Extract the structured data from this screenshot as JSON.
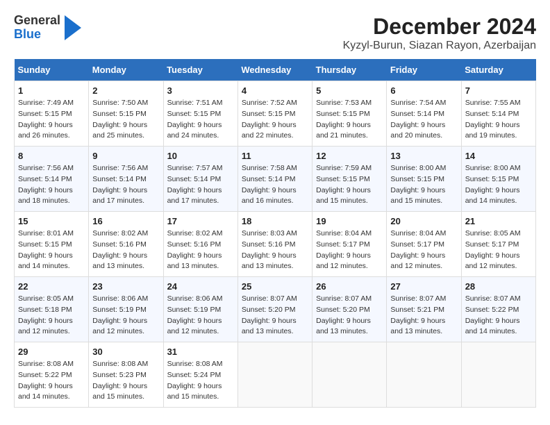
{
  "logo": {
    "general": "General",
    "blue": "Blue"
  },
  "title": "December 2024",
  "subtitle": "Kyzyl-Burun, Siazan Rayon, Azerbaijan",
  "headers": [
    "Sunday",
    "Monday",
    "Tuesday",
    "Wednesday",
    "Thursday",
    "Friday",
    "Saturday"
  ],
  "weeks": [
    [
      {
        "day": "1",
        "sunrise": "Sunrise: 7:49 AM",
        "sunset": "Sunset: 5:15 PM",
        "daylight": "Daylight: 9 hours and 26 minutes."
      },
      {
        "day": "2",
        "sunrise": "Sunrise: 7:50 AM",
        "sunset": "Sunset: 5:15 PM",
        "daylight": "Daylight: 9 hours and 25 minutes."
      },
      {
        "day": "3",
        "sunrise": "Sunrise: 7:51 AM",
        "sunset": "Sunset: 5:15 PM",
        "daylight": "Daylight: 9 hours and 24 minutes."
      },
      {
        "day": "4",
        "sunrise": "Sunrise: 7:52 AM",
        "sunset": "Sunset: 5:15 PM",
        "daylight": "Daylight: 9 hours and 22 minutes."
      },
      {
        "day": "5",
        "sunrise": "Sunrise: 7:53 AM",
        "sunset": "Sunset: 5:15 PM",
        "daylight": "Daylight: 9 hours and 21 minutes."
      },
      {
        "day": "6",
        "sunrise": "Sunrise: 7:54 AM",
        "sunset": "Sunset: 5:14 PM",
        "daylight": "Daylight: 9 hours and 20 minutes."
      },
      {
        "day": "7",
        "sunrise": "Sunrise: 7:55 AM",
        "sunset": "Sunset: 5:14 PM",
        "daylight": "Daylight: 9 hours and 19 minutes."
      }
    ],
    [
      {
        "day": "8",
        "sunrise": "Sunrise: 7:56 AM",
        "sunset": "Sunset: 5:14 PM",
        "daylight": "Daylight: 9 hours and 18 minutes."
      },
      {
        "day": "9",
        "sunrise": "Sunrise: 7:56 AM",
        "sunset": "Sunset: 5:14 PM",
        "daylight": "Daylight: 9 hours and 17 minutes."
      },
      {
        "day": "10",
        "sunrise": "Sunrise: 7:57 AM",
        "sunset": "Sunset: 5:14 PM",
        "daylight": "Daylight: 9 hours and 17 minutes."
      },
      {
        "day": "11",
        "sunrise": "Sunrise: 7:58 AM",
        "sunset": "Sunset: 5:14 PM",
        "daylight": "Daylight: 9 hours and 16 minutes."
      },
      {
        "day": "12",
        "sunrise": "Sunrise: 7:59 AM",
        "sunset": "Sunset: 5:15 PM",
        "daylight": "Daylight: 9 hours and 15 minutes."
      },
      {
        "day": "13",
        "sunrise": "Sunrise: 8:00 AM",
        "sunset": "Sunset: 5:15 PM",
        "daylight": "Daylight: 9 hours and 15 minutes."
      },
      {
        "day": "14",
        "sunrise": "Sunrise: 8:00 AM",
        "sunset": "Sunset: 5:15 PM",
        "daylight": "Daylight: 9 hours and 14 minutes."
      }
    ],
    [
      {
        "day": "15",
        "sunrise": "Sunrise: 8:01 AM",
        "sunset": "Sunset: 5:15 PM",
        "daylight": "Daylight: 9 hours and 14 minutes."
      },
      {
        "day": "16",
        "sunrise": "Sunrise: 8:02 AM",
        "sunset": "Sunset: 5:16 PM",
        "daylight": "Daylight: 9 hours and 13 minutes."
      },
      {
        "day": "17",
        "sunrise": "Sunrise: 8:02 AM",
        "sunset": "Sunset: 5:16 PM",
        "daylight": "Daylight: 9 hours and 13 minutes."
      },
      {
        "day": "18",
        "sunrise": "Sunrise: 8:03 AM",
        "sunset": "Sunset: 5:16 PM",
        "daylight": "Daylight: 9 hours and 13 minutes."
      },
      {
        "day": "19",
        "sunrise": "Sunrise: 8:04 AM",
        "sunset": "Sunset: 5:17 PM",
        "daylight": "Daylight: 9 hours and 12 minutes."
      },
      {
        "day": "20",
        "sunrise": "Sunrise: 8:04 AM",
        "sunset": "Sunset: 5:17 PM",
        "daylight": "Daylight: 9 hours and 12 minutes."
      },
      {
        "day": "21",
        "sunrise": "Sunrise: 8:05 AM",
        "sunset": "Sunset: 5:17 PM",
        "daylight": "Daylight: 9 hours and 12 minutes."
      }
    ],
    [
      {
        "day": "22",
        "sunrise": "Sunrise: 8:05 AM",
        "sunset": "Sunset: 5:18 PM",
        "daylight": "Daylight: 9 hours and 12 minutes."
      },
      {
        "day": "23",
        "sunrise": "Sunrise: 8:06 AM",
        "sunset": "Sunset: 5:19 PM",
        "daylight": "Daylight: 9 hours and 12 minutes."
      },
      {
        "day": "24",
        "sunrise": "Sunrise: 8:06 AM",
        "sunset": "Sunset: 5:19 PM",
        "daylight": "Daylight: 9 hours and 12 minutes."
      },
      {
        "day": "25",
        "sunrise": "Sunrise: 8:07 AM",
        "sunset": "Sunset: 5:20 PM",
        "daylight": "Daylight: 9 hours and 13 minutes."
      },
      {
        "day": "26",
        "sunrise": "Sunrise: 8:07 AM",
        "sunset": "Sunset: 5:20 PM",
        "daylight": "Daylight: 9 hours and 13 minutes."
      },
      {
        "day": "27",
        "sunrise": "Sunrise: 8:07 AM",
        "sunset": "Sunset: 5:21 PM",
        "daylight": "Daylight: 9 hours and 13 minutes."
      },
      {
        "day": "28",
        "sunrise": "Sunrise: 8:07 AM",
        "sunset": "Sunset: 5:22 PM",
        "daylight": "Daylight: 9 hours and 14 minutes."
      }
    ],
    [
      {
        "day": "29",
        "sunrise": "Sunrise: 8:08 AM",
        "sunset": "Sunset: 5:22 PM",
        "daylight": "Daylight: 9 hours and 14 minutes."
      },
      {
        "day": "30",
        "sunrise": "Sunrise: 8:08 AM",
        "sunset": "Sunset: 5:23 PM",
        "daylight": "Daylight: 9 hours and 15 minutes."
      },
      {
        "day": "31",
        "sunrise": "Sunrise: 8:08 AM",
        "sunset": "Sunset: 5:24 PM",
        "daylight": "Daylight: 9 hours and 15 minutes."
      },
      null,
      null,
      null,
      null
    ]
  ]
}
